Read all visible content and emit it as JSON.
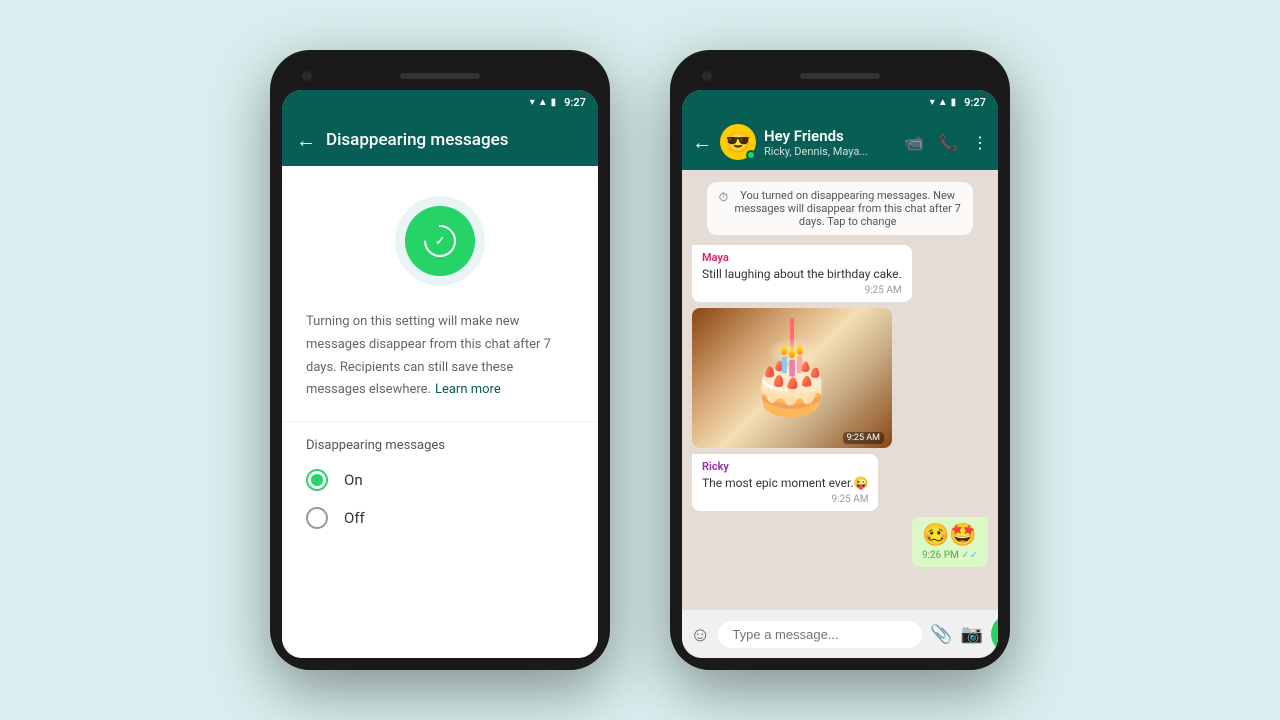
{
  "background_color": "#d9eeee",
  "phone1": {
    "status_bar": {
      "time": "9:27"
    },
    "toolbar": {
      "title": "Disappearing messages",
      "back_label": "←"
    },
    "description": "Turning on this setting will make new messages disappear from this chat after 7 days. Recipients can still save these messages elsewhere.",
    "learn_more": "Learn more",
    "section_label": "Disappearing messages",
    "options": [
      {
        "id": "on",
        "label": "On",
        "checked": true
      },
      {
        "id": "off",
        "label": "Off",
        "checked": false
      }
    ]
  },
  "phone2": {
    "status_bar": {
      "time": "9:27"
    },
    "toolbar": {
      "group_name": "Hey Friends",
      "members": "Ricky, Dennis, Maya...",
      "back_label": "←"
    },
    "system_message": "You turned on disappearing messages. New messages will disappear from this chat after 7 days. Tap to change",
    "messages": [
      {
        "type": "received",
        "sender": "Maya",
        "sender_color": "maya",
        "text": "Still laughing about the birthday cake.",
        "time": "9:25 AM"
      },
      {
        "type": "image",
        "time": "9:25 AM"
      },
      {
        "type": "received",
        "sender": "Ricky",
        "sender_color": "ricky",
        "text": "The most epic moment ever.😜",
        "time": "9:25 AM"
      },
      {
        "type": "sent_emoji",
        "emoji": "🥴🤩",
        "time": "9:26 PM",
        "checkmarks": "✓✓"
      }
    ],
    "input_placeholder": "Type a message..."
  }
}
